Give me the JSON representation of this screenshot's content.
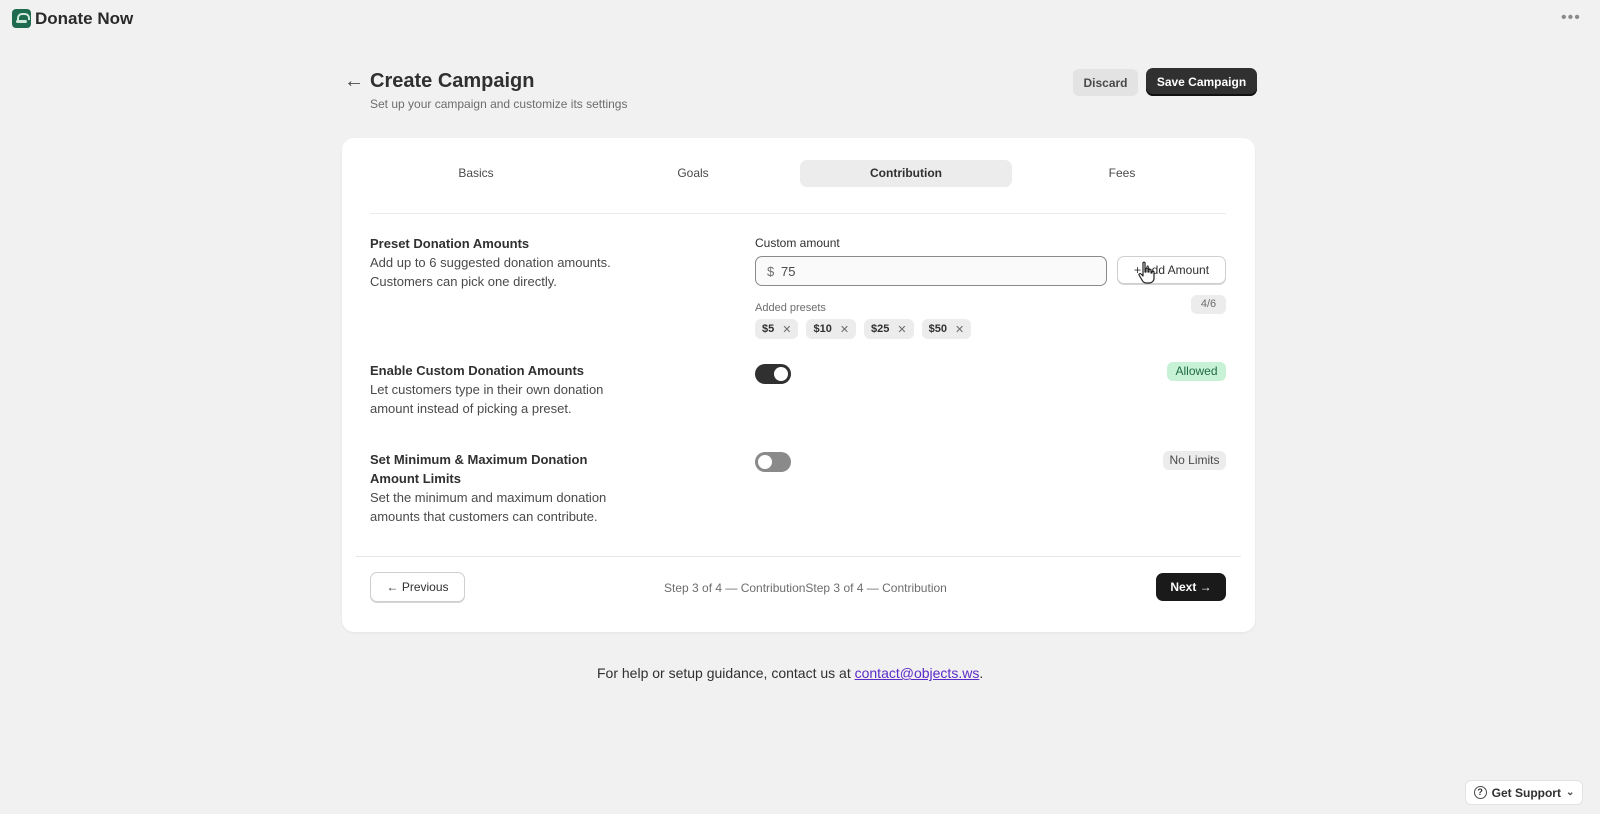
{
  "app": {
    "name": "Donate Now",
    "more_icon": "more-icon"
  },
  "header": {
    "title": "Create Campaign",
    "subtitle": "Set up your campaign and customize its settings",
    "back_icon": "arrow-left-icon",
    "discard_label": "Discard",
    "save_label": "Save Campaign"
  },
  "tabs": [
    {
      "label": "Basics",
      "active": false
    },
    {
      "label": "Goals",
      "active": false
    },
    {
      "label": "Contribution",
      "active": true
    },
    {
      "label": "Fees",
      "active": false
    }
  ],
  "preset_section": {
    "title": "Preset Donation Amounts",
    "description": "Add up to 6 suggested donation amounts. Customers can pick one directly.",
    "custom_label": "Custom amount",
    "currency_prefix": "$",
    "input_value": "75",
    "add_label": "+ Add Amount",
    "added_label": "Added presets",
    "count": "4/6",
    "presets": [
      "$5",
      "$10",
      "$25",
      "$50"
    ]
  },
  "custom_section": {
    "title": "Enable Custom Donation Amounts",
    "description": "Let customers type in their own donation amount instead of picking a preset.",
    "toggle_on": true,
    "badge": "Allowed"
  },
  "limits_section": {
    "title": "Set Minimum & Maximum Donation Amount Limits",
    "description": "Set the minimum and maximum donation amounts that customers can contribute.",
    "toggle_on": false,
    "badge": "No Limits"
  },
  "footer_nav": {
    "previous_label": "← Previous",
    "step_text": "Step 3 of 4 — ContributionStep 3 of 4 — Contribution",
    "next_label": "Next →"
  },
  "help": {
    "text": "For help or setup guidance, contact us at ",
    "email": "contact@objects.ws",
    "suffix": "."
  },
  "support": {
    "label": "Get Support"
  },
  "colors": {
    "primary": "#303030",
    "success_bg": "#c7f2d6",
    "success_text": "#1f6b44",
    "link": "#5a2cc7"
  }
}
